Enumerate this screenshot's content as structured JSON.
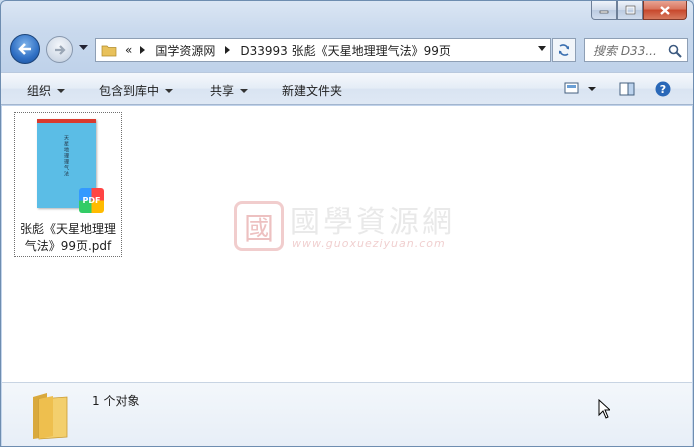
{
  "window": {
    "caption": {
      "minimize": "minimize",
      "maximize": "maximize",
      "close": "close"
    }
  },
  "address": {
    "overflow": "«",
    "crumbs": [
      "国学资源网",
      "D33993 张彪《天星地理理气法》99页"
    ]
  },
  "search": {
    "placeholder": "搜索 D33..."
  },
  "toolbar": {
    "organize": "组织",
    "include_in_library": "包含到库中",
    "share": "共享",
    "new_folder": "新建文件夹"
  },
  "files": [
    {
      "name": "张彪《天星地理理气法》99页.pdf",
      "thumb_text": "天星地理理气法",
      "badge": "PDF",
      "type": "pdf"
    }
  ],
  "watermark": {
    "seal": "國",
    "title": "國學資源網",
    "url": "www.guoxueziyuan.com"
  },
  "details": {
    "count": "1 个对象"
  },
  "colors": {
    "thumb": "#5bbde6",
    "thumb_top": "#d93a2e",
    "close": "#c7472b"
  }
}
